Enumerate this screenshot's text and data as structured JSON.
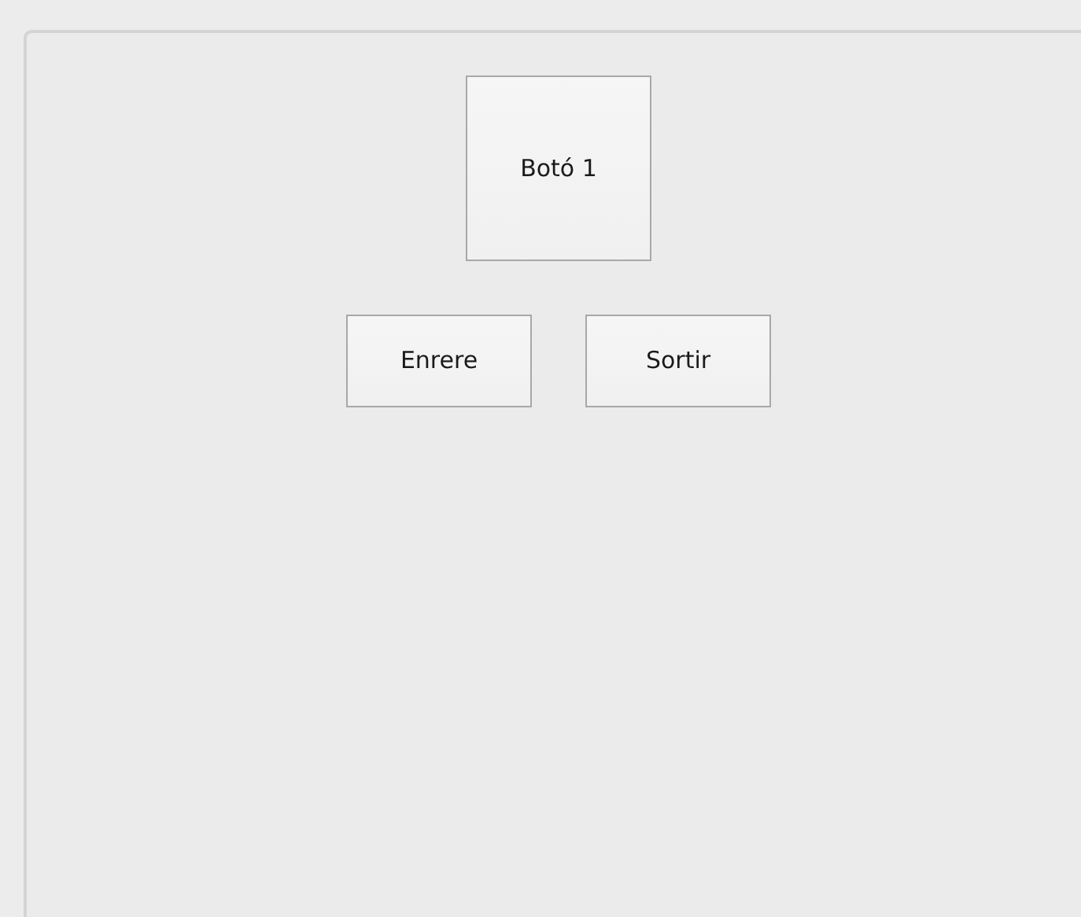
{
  "main_button": {
    "label": "Botó 1"
  },
  "buttons": [
    {
      "label": "Enrere"
    },
    {
      "label": "Sortir"
    }
  ]
}
